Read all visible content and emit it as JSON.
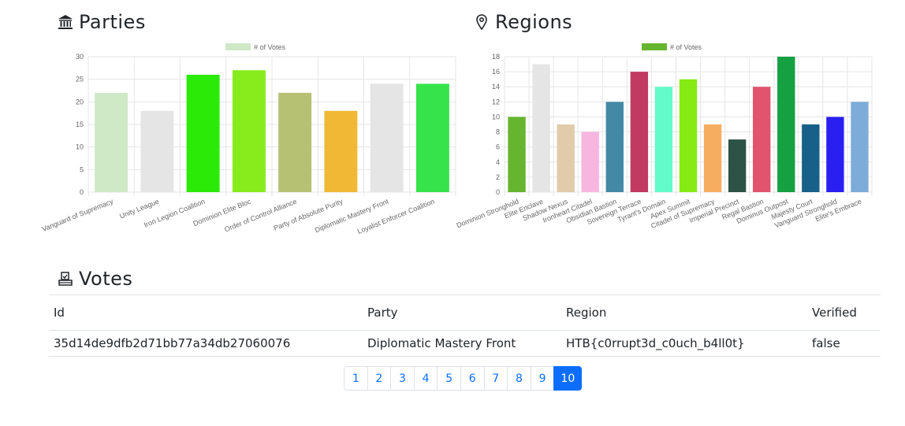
{
  "parties": {
    "title": "Parties",
    "icon": "bank-icon",
    "chart_data": {
      "type": "bar",
      "legend": "# of Votes",
      "legend_color": "#cfe8c6",
      "legend_position": "top",
      "categories": [
        "Vanguard of Supremacy",
        "Unity League",
        "Iron Legion Coalition",
        "Dominion Elite Bloc",
        "Order of Control Alliance",
        "Party of Absolute Purity",
        "Diplomatic Mastery Front",
        "Loyalist Enforcer Coalition"
      ],
      "values": [
        22,
        18,
        26,
        27,
        22,
        18,
        24,
        24
      ],
      "colors": [
        "#cfe8c6",
        "#e5e5e5",
        "#2bea08",
        "#87eb1c",
        "#b6c173",
        "#f0b834",
        "#e5e5e5",
        "#36e34a"
      ],
      "ylim": [
        0,
        30
      ],
      "yticks": [
        0,
        5,
        10,
        15,
        20,
        25,
        30
      ],
      "grid": true
    }
  },
  "regions": {
    "title": "Regions",
    "icon": "map-pin-icon",
    "chart_data": {
      "type": "bar",
      "legend": "# of Votes",
      "legend_color": "#66b52f",
      "legend_position": "top",
      "categories": [
        "Dominion Stronghold",
        "Elite Enclave",
        "Shadow Nexus",
        "Ironheart Citadel",
        "Obsidian Bastion",
        "Sovereign Terrace",
        "Tyrant's Domain",
        "Apex Summit",
        "Citadel of Supremacy",
        "Imperial Precinct",
        "Regal Bastion",
        "Dominus Outpost",
        "Majesty Court",
        "Vanguard Stronghold",
        "Elite's Embrace"
      ],
      "values": [
        10,
        17,
        9,
        8,
        12,
        16,
        14,
        15,
        9,
        7,
        14,
        18,
        9,
        10,
        12
      ],
      "colors": [
        "#66b52f",
        "#e5e5e5",
        "#e1cbaa",
        "#f7b6e0",
        "#4389a6",
        "#c13a62",
        "#62fbc9",
        "#86eb13",
        "#f6ad60",
        "#2d5246",
        "#e2546e",
        "#15a042",
        "#16608a",
        "#2a1ff1",
        "#7dacd9"
      ],
      "ylim": [
        0,
        18
      ],
      "yticks": [
        0,
        2,
        4,
        6,
        8,
        10,
        12,
        14,
        16,
        18
      ],
      "grid": true
    }
  },
  "votes": {
    "title": "Votes",
    "icon": "ballot-box-icon",
    "columns": [
      "Id",
      "Party",
      "Region",
      "Verified"
    ],
    "rows": [
      [
        "35d14de9dfb2d71bb77a34db27060076",
        "Diplomatic Mastery Front",
        "HTB{c0rrupt3d_c0uch_b4ll0t}",
        "false"
      ]
    ]
  },
  "pagination": {
    "pages": [
      "1",
      "2",
      "3",
      "4",
      "5",
      "6",
      "7",
      "8",
      "9",
      "10"
    ],
    "active": "10",
    "accent_color": "#0d6efd"
  }
}
